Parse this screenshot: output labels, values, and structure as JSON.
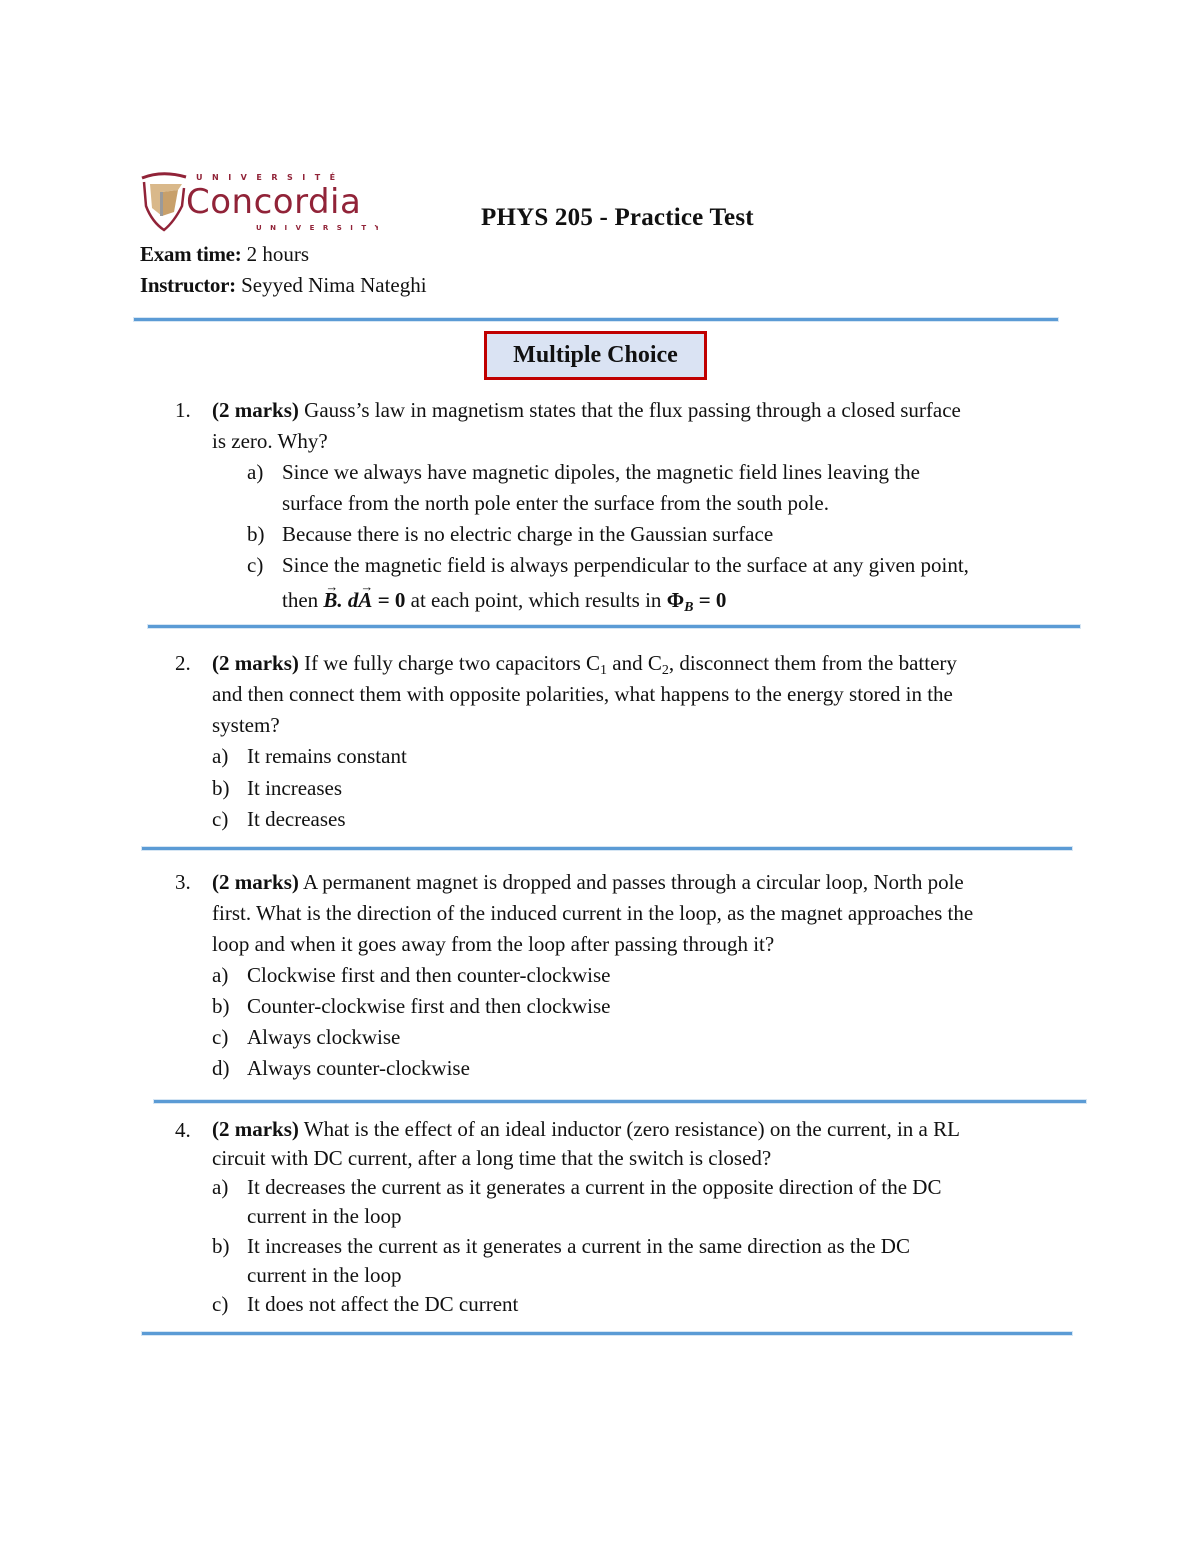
{
  "header": {
    "logo": {
      "top_text": "UNIVERSITÉ",
      "name": "Concordia",
      "bottom_text": "UNIVERSITY",
      "colors": {
        "maroon": "#912338",
        "tan": "#d9b88a",
        "grey": "#9a9a9a"
      }
    },
    "title": "PHYS 205 - Practice Test",
    "exam_time_label": "Exam time:",
    "exam_time_value": "2 hours",
    "instructor_label": "Instructor:",
    "instructor_value": "Seyyed Nima Nateghi"
  },
  "section": {
    "title": "Multiple Choice",
    "border_color": "#c00000",
    "fill_color": "#dae3f3"
  },
  "divider_color": "#5b9bd5",
  "questions": [
    {
      "number": "1.",
      "marks": "(2 marks)",
      "text_line1": "Gauss’s law in magnetism states that the flux passing through a closed surface",
      "text_line2": "is zero. Why?",
      "options": [
        {
          "label": "a)",
          "line1": "Since we always have magnetic dipoles, the magnetic field lines leaving the",
          "line2": "surface from the north pole enter the surface from the south pole."
        },
        {
          "label": "b)",
          "line1": "Because there is no electric charge in the Gaussian surface"
        },
        {
          "label": "c)",
          "line1": "Since the magnetic field is always perpendicular to the surface at any given point,",
          "line2_prefix": "then",
          "line2_math1_B": "B",
          "line2_math1_dot": ". d",
          "line2_math1_A": "A",
          "line2_math1_eq": " = 0",
          "line2_mid": "at each point, which results in",
          "line2_math2_phi": "Φ",
          "line2_math2_sub": "B",
          "line2_math2_eq": " = 0"
        }
      ]
    },
    {
      "number": "2.",
      "marks": "(2 marks)",
      "text_line1_a": "If we fully charge two capacitors C",
      "text_line1_sub1": "1",
      "text_line1_b": " and C",
      "text_line1_sub2": "2",
      "text_line1_c": ", disconnect them from the battery",
      "text_line2": "and then connect them with opposite polarities, what happens to the energy stored in the",
      "text_line3": "system?",
      "options": [
        {
          "label": "a)",
          "line1": "It remains constant"
        },
        {
          "label": "b)",
          "line1": "It increases"
        },
        {
          "label": "c)",
          "line1": "It decreases"
        }
      ]
    },
    {
      "number": "3.",
      "marks": "(2 marks)",
      "text_line1": "A permanent magnet is dropped and passes through a circular loop, North pole",
      "text_line2": "first. What is the direction of the induced current in the loop, as the magnet approaches the",
      "text_line3": "loop and when it goes away from the loop after passing through it?",
      "options": [
        {
          "label": "a)",
          "line1": "Clockwise first and then counter-clockwise"
        },
        {
          "label": "b)",
          "line1": "Counter-clockwise first and then clockwise"
        },
        {
          "label": "c)",
          "line1": "Always clockwise"
        },
        {
          "label": "d)",
          "line1": "Always counter-clockwise"
        }
      ]
    },
    {
      "number": "4.",
      "marks": "(2 marks)",
      "text_line1": "What is the effect of an ideal inductor (zero resistance) on the current, in a RL",
      "text_line2": "circuit with DC current, after a long time that the switch is closed?",
      "options": [
        {
          "label": "a)",
          "line1": "It decreases the current as it generates a current in the opposite direction of the DC",
          "line2": "current in the loop"
        },
        {
          "label": "b)",
          "line1": "It increases the current as it generates a current in the same direction as the DC",
          "line2": "current in the loop"
        },
        {
          "label": "c)",
          "line1": "It does not affect the DC current"
        }
      ]
    }
  ]
}
